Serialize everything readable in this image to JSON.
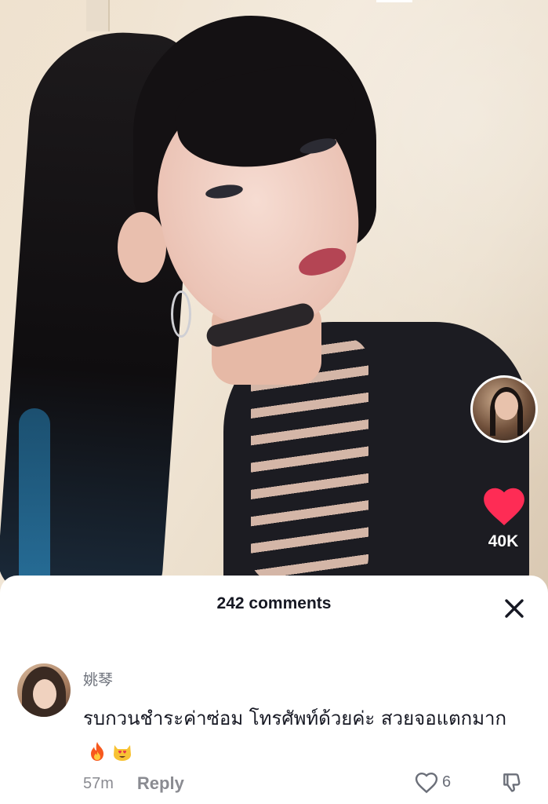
{
  "video": {
    "like_count": "40K",
    "accent_color": "#fe2c55"
  },
  "comments_sheet": {
    "title": "242 comments",
    "close_icon": "close-icon",
    "comments": [
      {
        "username": "姚琴",
        "text": "รบกวนชำระค่าซ่อม โทรศัพท์ด้วยค่ะ สวยจอแตกมาก",
        "emojis": [
          "fire-emoji",
          "heart-eyes-cat-emoji"
        ],
        "time": "57m",
        "reply_label": "Reply",
        "like_count": "6"
      }
    ]
  }
}
